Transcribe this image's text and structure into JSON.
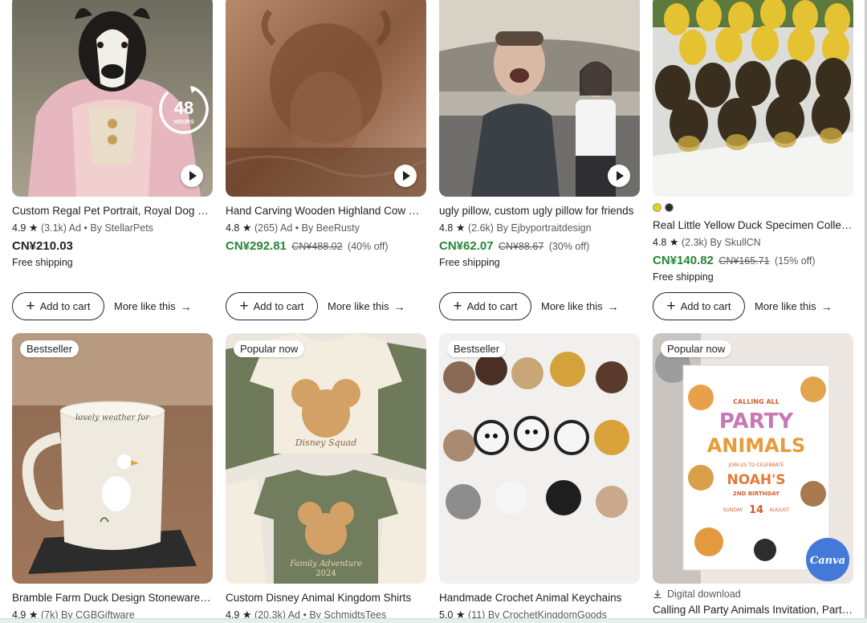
{
  "ui": {
    "add_to_cart": "Add to cart",
    "more_like_this": "More like this",
    "plus_glyph": "+",
    "arrow_glyph": "→",
    "star_glyph": "★",
    "ad_label": "Ad",
    "by_prefix": "• By",
    "by_plain": "By",
    "free_shipping": "Free shipping"
  },
  "row1": [
    {
      "title": "Custom Regal Pet Portrait, Royal Dog Portrait from Photo",
      "rating": "4.9",
      "reviews": "(3.1k)",
      "ad": true,
      "shop": "StellarPets",
      "price": "CN¥210.03",
      "original_price": "",
      "discount": "",
      "free_shipping": true,
      "badge_48": {
        "number": "48",
        "unit": "HOURS"
      }
    },
    {
      "title": "Hand Carving Wooden Highland Cow Sculpture",
      "rating": "4.8",
      "reviews": "(265)",
      "ad": true,
      "shop": "BeeRusty",
      "price": "CN¥292.81",
      "original_price": "CN¥488.02",
      "discount": "(40% off)",
      "free_shipping": false
    },
    {
      "title": "ugly pillow, custom ugly pillow for friends",
      "rating": "4.8",
      "reviews": "(2.6k)",
      "ad": false,
      "shop": "Ejbyportraitdesign",
      "price": "CN¥62.07",
      "original_price": "CN¥88.67",
      "discount": "(30% off)",
      "free_shipping": true
    },
    {
      "title": "Real Little Yellow Duck Specimen Collection",
      "rating": "4.8",
      "reviews": "(2.3k)",
      "ad": false,
      "shop": "SkullCN",
      "price": "CN¥140.82",
      "original_price": "CN¥165.71",
      "discount": "(15% off)",
      "free_shipping": true,
      "swatches": [
        "#e5d21b",
        "#2a2a2a"
      ]
    }
  ],
  "row2": [
    {
      "pill": "Bestseller",
      "title": "Bramble Farm Duck Design Stoneware Mug",
      "rating": "4.9",
      "reviews": "(7k)",
      "ad": false,
      "shop": "CGBGiftware",
      "mug_text": "lovely weather for"
    },
    {
      "pill": "Popular now",
      "title": "Custom Disney Animal Kingdom Shirts",
      "rating": "4.9",
      "reviews": "(20.3k)",
      "ad": true,
      "shop": "SchmidtsTees",
      "shirt_texts": [
        "Disney Squad",
        "Family Adventure",
        "2024"
      ]
    },
    {
      "pill": "Bestseller",
      "title": "Handmade Crochet Animal Keychains",
      "rating": "5.0",
      "reviews": "(11)",
      "ad": false,
      "shop": "CrochetKingdomGoods"
    },
    {
      "pill": "Popular now",
      "digital_label": "Digital download",
      "title": "Calling All Party Animals Invitation, Party Animals Birthday",
      "invite": {
        "top": "CALLING ALL",
        "line1": "PARTY",
        "line2": "ANIMALS",
        "join": "JOIN US TO CELEBRATE",
        "name": "NOAH'S",
        "birthday": "2ND BIRTHDAY",
        "day": "SUNDAY",
        "date": "14",
        "month": "AUGUST",
        "logo": "Canva"
      }
    }
  ]
}
